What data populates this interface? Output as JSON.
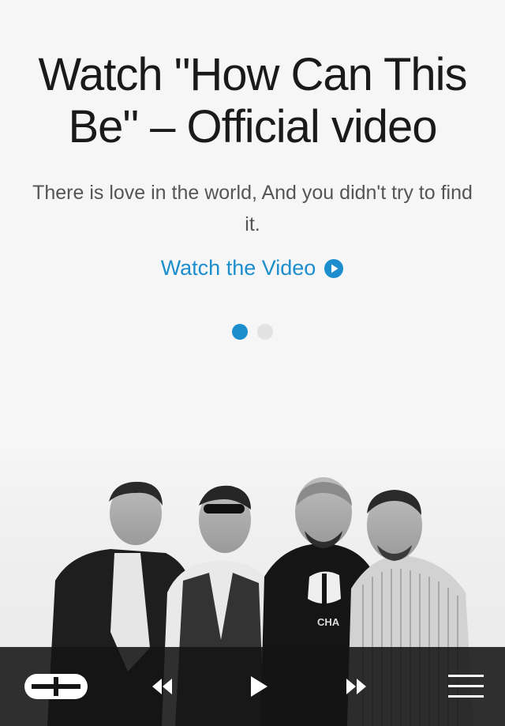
{
  "hero": {
    "title": "Watch \"How Can This Be\" – Official video",
    "description": "There is love in the world, And you didn't try to find it.",
    "watch_label": "Watch the Video",
    "pager": {
      "count": 2,
      "active": 0
    }
  },
  "photo": {
    "shirt_text": "CHA"
  },
  "colors": {
    "accent": "#1c8ecd",
    "background": "#f6f6f6",
    "player_bar": "#141414"
  },
  "player": {
    "icons": [
      "logo-icon",
      "rewind-icon",
      "play-icon",
      "fast-forward-icon",
      "menu-icon"
    ]
  }
}
